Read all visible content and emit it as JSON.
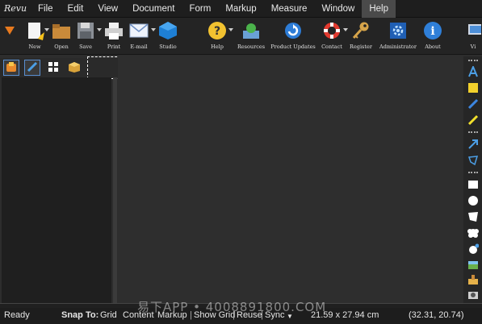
{
  "app": {
    "logo_text": "Revu"
  },
  "menu": [
    {
      "label": "File"
    },
    {
      "label": "Edit"
    },
    {
      "label": "View"
    },
    {
      "label": "Document"
    },
    {
      "label": "Form"
    },
    {
      "label": "Markup"
    },
    {
      "label": "Measure"
    },
    {
      "label": "Window"
    },
    {
      "label": "Help",
      "active": true
    }
  ],
  "toolbar": {
    "new": "New",
    "open": "Open",
    "save": "Save",
    "print": "Print",
    "email": "E-mail",
    "studio": "Studio",
    "help": "Help",
    "resources": "Resources",
    "product_updates": "Product Updates",
    "contact": "Contact",
    "register": "Register",
    "administrator": "Administrator",
    "about": "About",
    "view_cut": "Vi"
  },
  "status": {
    "ready": "Ready",
    "snap_to": "Snap To:",
    "grid": "Grid",
    "content": "Content",
    "markup": "Markup",
    "show_grid": "Show Grid",
    "reuse": "Reuse",
    "sync": "Sync",
    "page_size": "21.59 x 27.94 cm",
    "coords": "(32.31, 20.74)"
  },
  "watermark": "易下APP • 4008891800.COM",
  "colors": {
    "accent": "#5a8fd0",
    "bg": "#2e2e2e"
  }
}
